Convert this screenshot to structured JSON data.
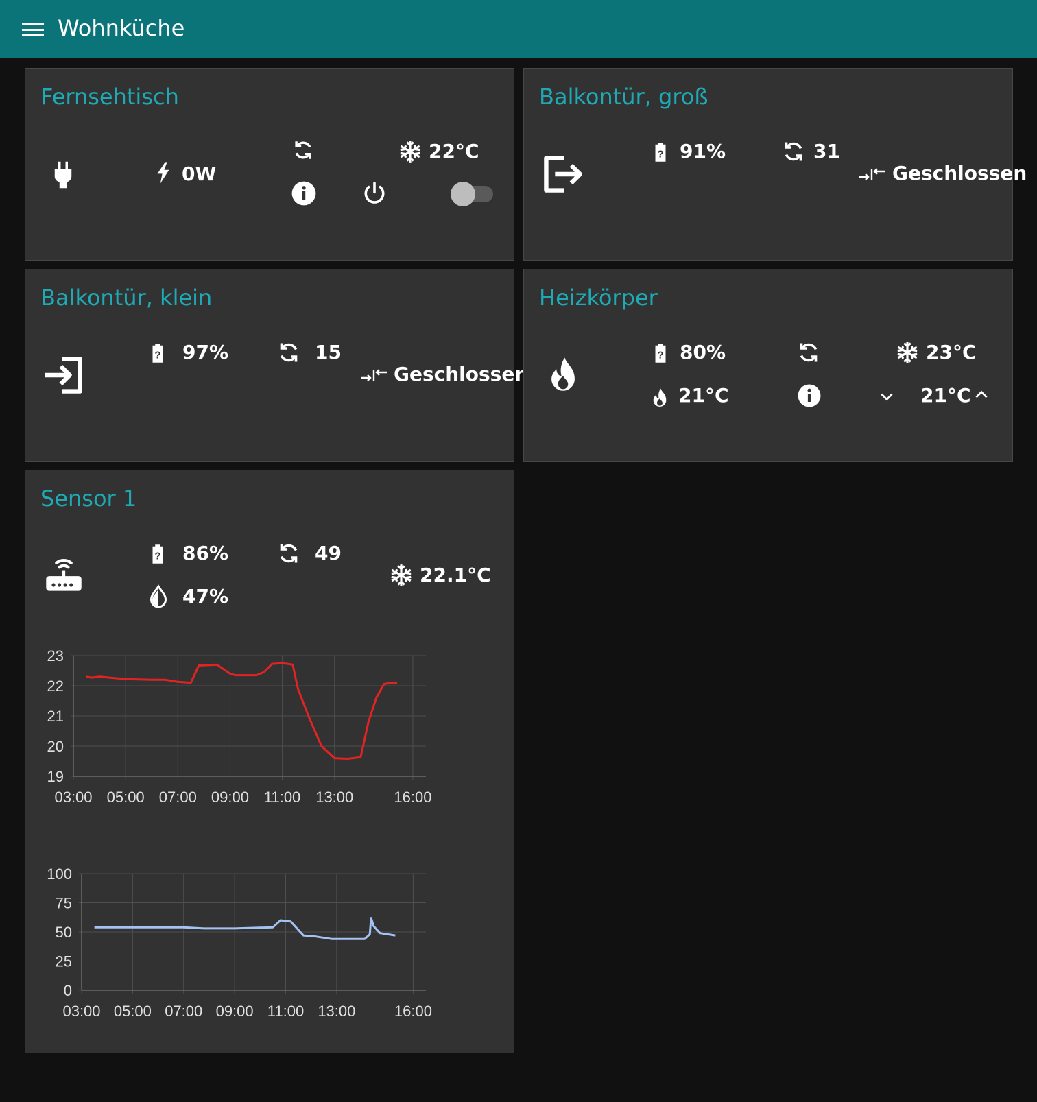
{
  "header": {
    "title": "Wohnküche"
  },
  "cards": [
    {
      "title": "Fernsehtisch",
      "device_icon": "power-plug-icon",
      "power": "0W",
      "temperature": "22°C",
      "switch_on": false
    },
    {
      "title": "Balkontür, groß",
      "device_icon": "exit-door-icon",
      "battery": "91%",
      "link": "31",
      "state": "Geschlossen"
    },
    {
      "title": "Balkontür, klein",
      "device_icon": "enter-door-icon",
      "battery": "97%",
      "link": "15",
      "state": "Geschlossen"
    },
    {
      "title": "Heizkörper",
      "device_icon": "fire-icon",
      "battery": "80%",
      "temperature": "23°C",
      "heating_temp": "21°C",
      "setpoint": "21°C"
    },
    {
      "title": "Sensor 1",
      "device_icon": "router-wireless-icon",
      "battery": "86%",
      "link": "49",
      "humidity": "47%",
      "temperature": "22.1°C"
    }
  ],
  "colors": {
    "accent": "#1eaab5",
    "header": "#0a7479",
    "temp_line": "#e02424",
    "humidity_line": "#a4c2f4"
  },
  "chart_data": [
    {
      "type": "line",
      "title": "",
      "xlabel": "",
      "ylabel": "",
      "ylim": [
        19,
        23
      ],
      "yticks": [
        19,
        20,
        21,
        22,
        23
      ],
      "xlim": [
        3.0,
        16.5
      ],
      "xticks": [
        3,
        5,
        7,
        9,
        11,
        13,
        16
      ],
      "xtick_labels": [
        "03:00",
        "05:00",
        "07:00",
        "09:00",
        "11:00",
        "13:00",
        "16:00"
      ],
      "grid": true,
      "series": [
        {
          "x": [
            3.5,
            3.7,
            4.0,
            5.0,
            6.0,
            6.5,
            7.0,
            7.5,
            7.8,
            8.5,
            9.0,
            9.2,
            10.0,
            10.3,
            10.6,
            11.0,
            11.4,
            11.6,
            12.0,
            12.5,
            13.0,
            13.5,
            14.0,
            14.3,
            14.6,
            14.9,
            15.2,
            15.4
          ],
          "y": [
            22.3,
            22.27,
            22.3,
            22.22,
            22.2,
            22.2,
            22.13,
            22.1,
            22.67,
            22.7,
            22.4,
            22.35,
            22.35,
            22.45,
            22.72,
            22.75,
            22.7,
            21.9,
            21.0,
            20.0,
            19.6,
            19.58,
            19.63,
            20.8,
            21.6,
            22.06,
            22.1,
            22.08
          ]
        }
      ]
    },
    {
      "type": "line",
      "title": "",
      "xlabel": "",
      "ylabel": "",
      "ylim": [
        0,
        100
      ],
      "yticks": [
        0,
        25,
        50,
        75,
        100
      ],
      "xlim": [
        3.0,
        16.5
      ],
      "xticks": [
        3,
        5,
        7,
        9,
        11,
        13,
        16
      ],
      "xtick_labels": [
        "03:00",
        "05:00",
        "07:00",
        "09:00",
        "11:00",
        "13:00",
        "16:00"
      ],
      "grid": true,
      "series": [
        {
          "x": [
            3.5,
            5.0,
            7.0,
            7.8,
            9.0,
            10.5,
            10.8,
            11.2,
            11.7,
            12.2,
            12.8,
            13.5,
            14.1,
            14.3,
            14.35,
            14.45,
            14.7,
            15.0,
            15.3
          ],
          "y": [
            54,
            54,
            54,
            53,
            53,
            54,
            60,
            59,
            47,
            46,
            44,
            44,
            44,
            48,
            62,
            55,
            49,
            48,
            47
          ]
        }
      ]
    }
  ]
}
